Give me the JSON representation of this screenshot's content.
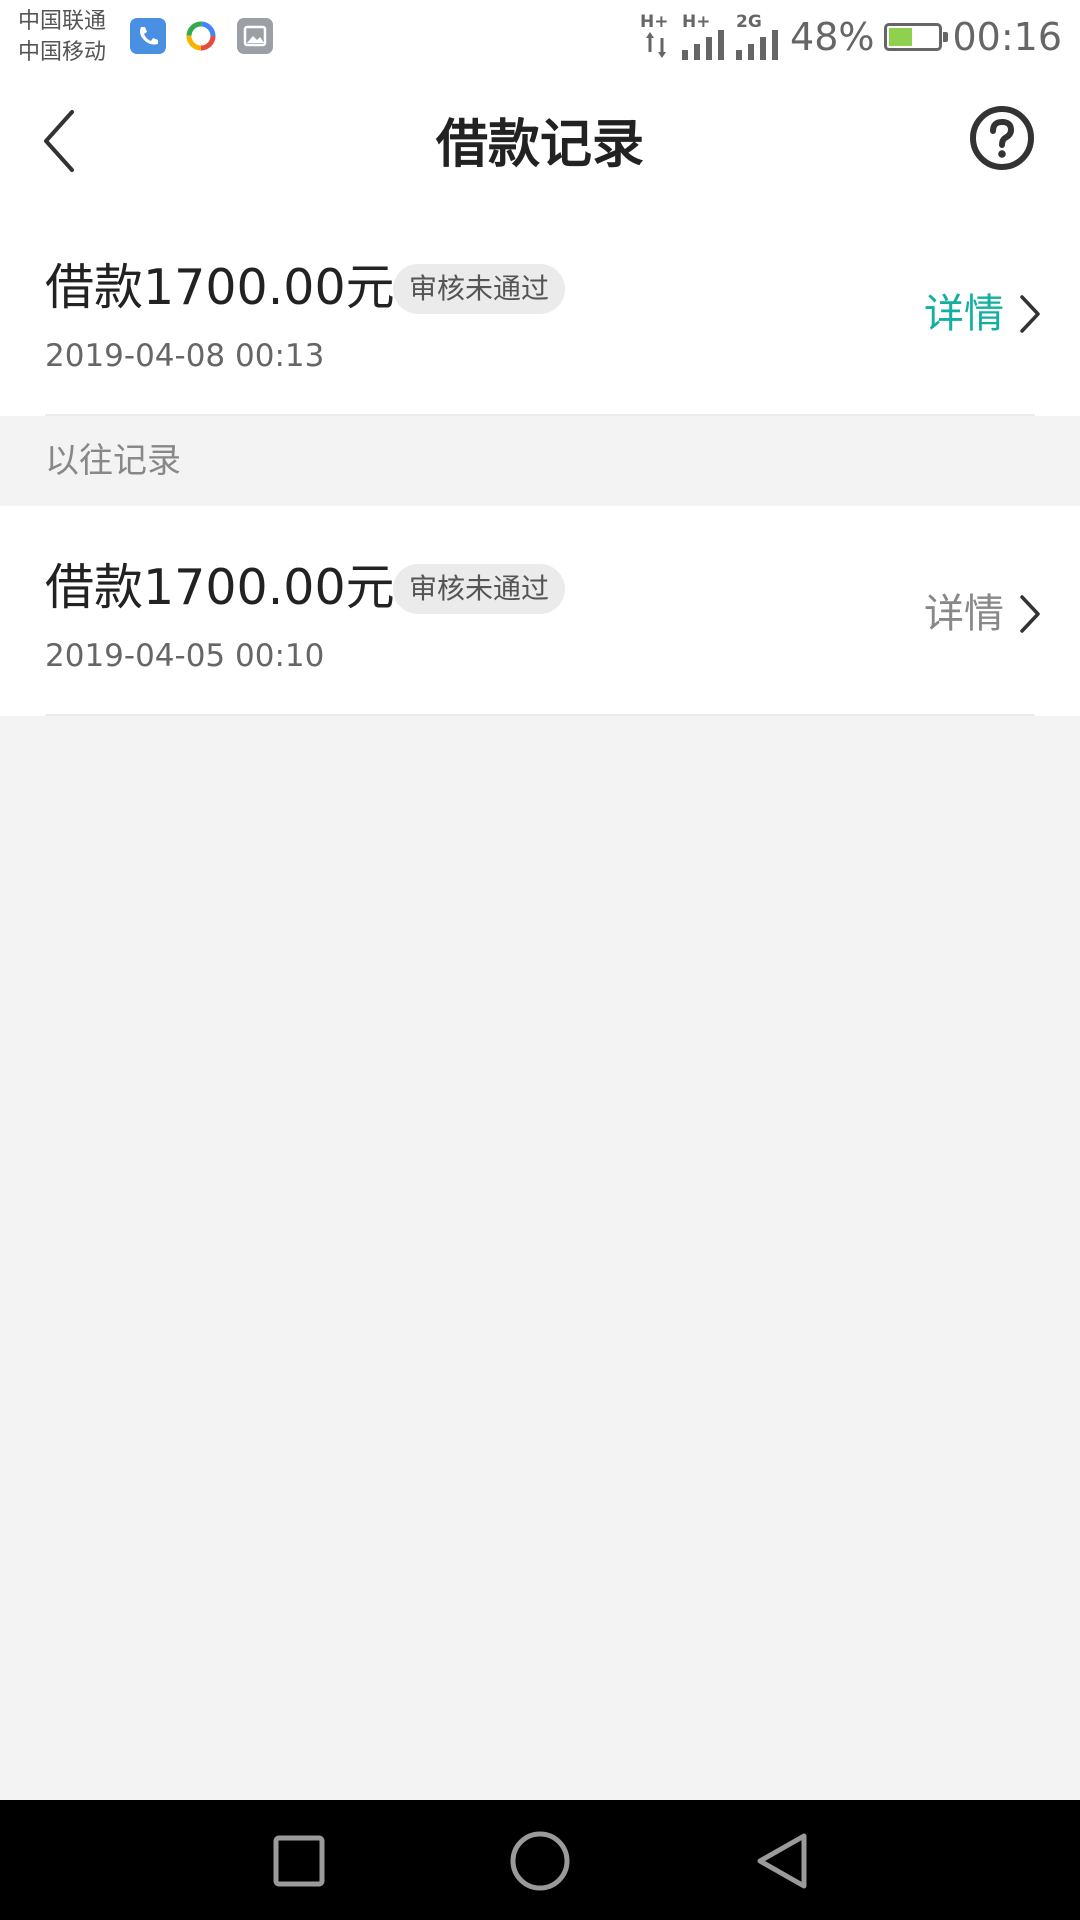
{
  "status_bar": {
    "carrier_1": "中国联通",
    "carrier_2": "中国移动",
    "net_1": "H+",
    "net_2": "H+",
    "net_3": "2G",
    "battery_percent": "48%",
    "battery_level": 0.48,
    "time": "00:16",
    "notification_icons": [
      "phone-icon",
      "app-icon",
      "gallery-icon"
    ]
  },
  "header": {
    "title": "借款记录",
    "back_icon": "chevron-left-icon",
    "help_icon": "question-circle-icon"
  },
  "current_record": {
    "amount": "借款1700.00元",
    "status": "审核未通过",
    "date": "2019-04-08 00:13",
    "detail_label": "详情",
    "detail_color": "#13b0a0"
  },
  "section": {
    "title": "以往记录"
  },
  "past_records": [
    {
      "amount": "借款1700.00元",
      "status": "审核未通过",
      "date": "2019-04-05 00:10",
      "detail_label": "详情",
      "detail_color": "#888888"
    }
  ],
  "nav_bar": {
    "icons": [
      "recent-apps-icon",
      "home-icon",
      "back-icon"
    ]
  }
}
